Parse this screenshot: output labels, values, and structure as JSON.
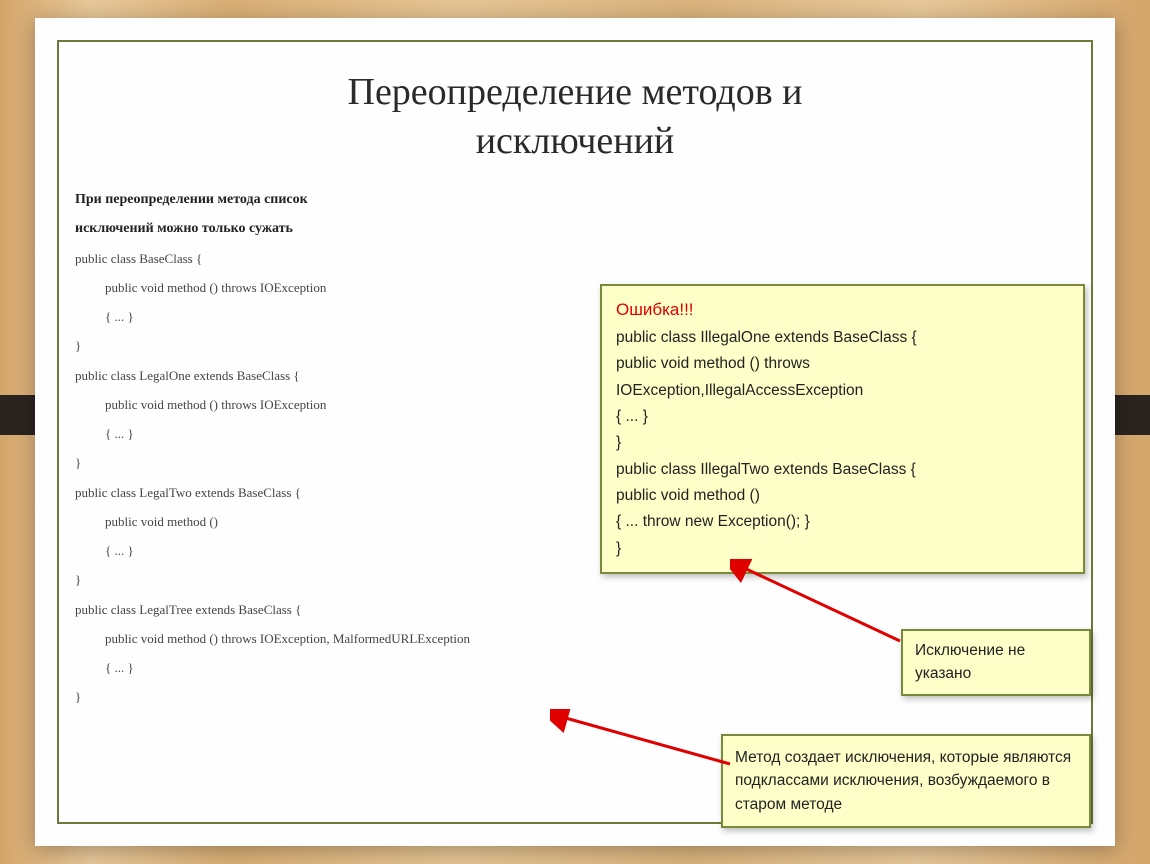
{
  "title_line1": "Переопределение методов и",
  "title_line2": "исключений",
  "intro_line1": "При переопределении метода список",
  "intro_line2": "исключений можно только сужать",
  "left_code": {
    "l1": "public class BaseClass {",
    "l2": "public void method () throws IOException",
    "l3": "{   ...   }",
    "l4": "}",
    "l5": "public class LegalOne extends BaseClass  {",
    "l6": "public void method () throws IOException",
    "l7": "{     ...   }",
    "l8": "}",
    "l9": "public class LegalTwo extends BaseClass  {",
    "l10": "public void method ()",
    "l11": "{     ...   }",
    "l12": "}",
    "l13": "public class LegalTree extends BaseClass  {",
    "l14": "public void method () throws IOException, MalformedURLException",
    "l15": "{     ...   }",
    "l16": "}"
  },
  "box1": {
    "err": "Ошибка!!!",
    "l1": "public  class  IllegalOne  extends  BaseClass  {",
    "l2": "        public  void  method ()  throws",
    "l3": "IOException,IllegalAccessException",
    "l4": "{       ...    }",
    "l5": "}",
    "l6": "public  class  IllegalTwo  extends  BaseClass  {",
    "l7": "public  void  method ()",
    "l8": "{       ...       throw  new  Exception();    }",
    "l9": "}"
  },
  "box2_text": "Исключение не указано",
  "box3_text": "Метод создает исключения,  которые являются подклассами исключения, возбуждаемого в старом методе"
}
